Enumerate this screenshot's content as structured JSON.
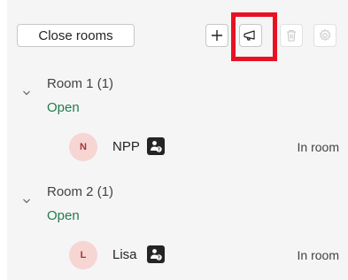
{
  "toolbar": {
    "close_rooms_label": "Close rooms",
    "add_icon": "plus-icon",
    "announce_icon": "megaphone-icon",
    "delete_icon": "trash-icon",
    "settings_icon": "gear-icon"
  },
  "highlight_color": "#e81123",
  "rooms": [
    {
      "name": "Room 1",
      "count": "(1)",
      "status": "Open",
      "participant": {
        "initial": "N",
        "name": "NPP",
        "status": "In room"
      }
    },
    {
      "name": "Room 2",
      "count": "(1)",
      "status": "Open",
      "participant": {
        "initial": "L",
        "name": "Lisa",
        "status": "In room"
      }
    }
  ],
  "colors": {
    "open_status": "#237b4b",
    "avatar_bg": "#f6d5d2",
    "avatar_text": "#a4373a",
    "panel_bg": "#f5f5f5"
  }
}
